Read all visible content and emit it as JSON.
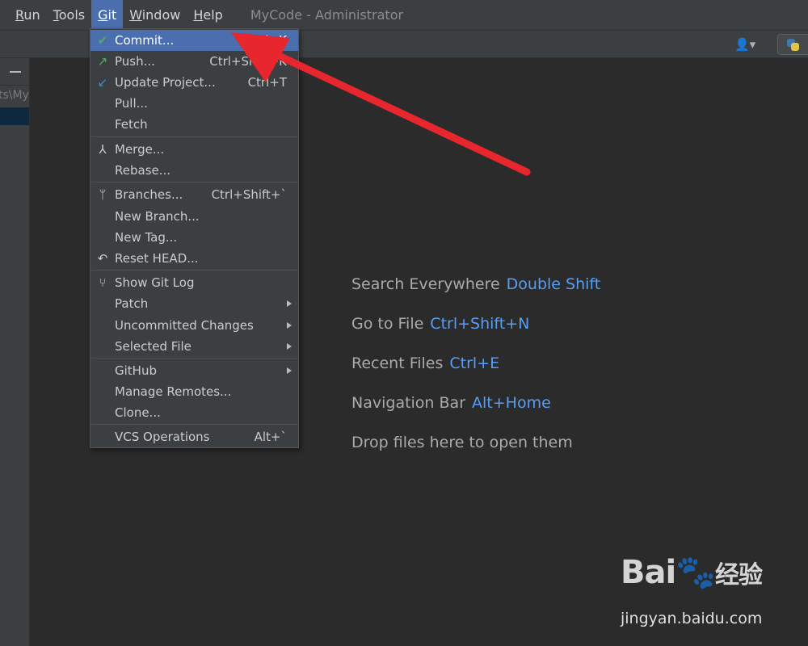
{
  "menubar": {
    "items": [
      "Run",
      "Tools",
      "Git",
      "Window",
      "Help"
    ],
    "title": "MyCode - Administrator"
  },
  "sidepanel": {
    "path": "ts\\My"
  },
  "git_menu": {
    "items": [
      {
        "icon": "✔",
        "label": "Commit...",
        "shortcut": "Ctrl+K"
      },
      {
        "icon": "↗",
        "label": "Push...",
        "shortcut": "Ctrl+Shift+K"
      },
      {
        "icon": "↙",
        "label": "Update Project...",
        "shortcut": "Ctrl+T"
      },
      {
        "label": "Pull..."
      },
      {
        "label": "Fetch"
      },
      {
        "icon": "⅄",
        "label": "Merge..."
      },
      {
        "label": "Rebase..."
      },
      {
        "icon": "ᛘ",
        "label": "Branches...",
        "shortcut": "Ctrl+Shift+`"
      },
      {
        "label": "New Branch..."
      },
      {
        "label": "New Tag..."
      },
      {
        "icon": "↶",
        "label": "Reset HEAD..."
      },
      {
        "icon": "⑂",
        "label": "Show Git Log"
      },
      {
        "label": "Patch"
      },
      {
        "label": "Uncommitted Changes"
      },
      {
        "label": "Selected File"
      },
      {
        "label": "GitHub"
      },
      {
        "label": "Manage Remotes..."
      },
      {
        "label": "Clone..."
      },
      {
        "label": "VCS Operations",
        "shortcut": "Alt+`"
      }
    ]
  },
  "hints": [
    {
      "text": "Search Everywhere",
      "key": "Double Shift"
    },
    {
      "text": "Go to File",
      "key": "Ctrl+Shift+N"
    },
    {
      "text": "Recent Files",
      "key": "Ctrl+E"
    },
    {
      "text": "Navigation Bar",
      "key": "Alt+Home"
    },
    {
      "text": "Drop files here to open them",
      "key": ""
    }
  ],
  "watermark": {
    "logo": "Bai",
    "logo_suffix": "du",
    "cn": "经验",
    "url": "jingyan.baidu.com"
  },
  "colors": {
    "accent": "#4b6eaf",
    "hint_key": "#589df6",
    "annotation": "#e8262d",
    "check": "#59a869",
    "push": "#59a869",
    "update": "#3592c4"
  }
}
